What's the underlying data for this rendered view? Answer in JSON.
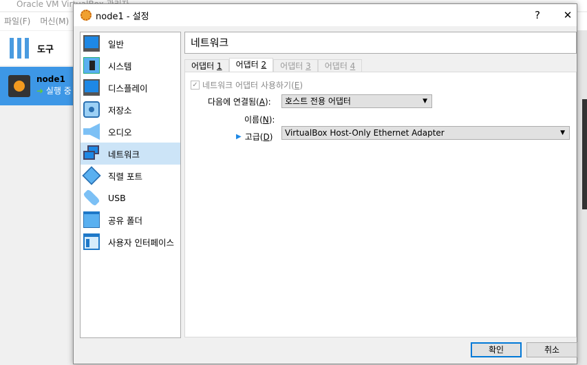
{
  "manager": {
    "title": "Oracle VM VirtualBox 관리자",
    "menu": [
      "파일(F)",
      "머신(M)"
    ],
    "tools_label": "도구",
    "vm": {
      "name": "node1",
      "state": "실행 중"
    }
  },
  "dialog": {
    "title": "node1 - 설정",
    "help": "?",
    "close": "✕",
    "sidebar": [
      {
        "label": "일반",
        "icon": "general-icon"
      },
      {
        "label": "시스템",
        "icon": "system-icon"
      },
      {
        "label": "디스플레이",
        "icon": "display-icon"
      },
      {
        "label": "저장소",
        "icon": "storage-icon"
      },
      {
        "label": "오디오",
        "icon": "audio-icon"
      },
      {
        "label": "네트워크",
        "icon": "network-icon",
        "selected": true
      },
      {
        "label": "직렬 포트",
        "icon": "serial-port-icon"
      },
      {
        "label": "USB",
        "icon": "usb-icon"
      },
      {
        "label": "공유 폴더",
        "icon": "shared-folder-icon"
      },
      {
        "label": "사용자 인터페이스",
        "icon": "user-interface-icon"
      }
    ],
    "page_title": "네트워크",
    "tabs": [
      {
        "label": "어댑터 ",
        "key": "1"
      },
      {
        "label": "어댑터 ",
        "key": "2"
      },
      {
        "label": "어댑터 ",
        "key": "3"
      },
      {
        "label": "어댑터 ",
        "key": "4"
      }
    ],
    "enable": {
      "label": "네트워크 어댑터 사용하기(",
      "key": "E",
      "end": ")",
      "checked": true
    },
    "attached": {
      "label": "다음에 연결됨(",
      "key": "A",
      "end": "):",
      "value": "호스트 전용 어댑터"
    },
    "name": {
      "label": "이름(",
      "key": "N",
      "end": "):",
      "value": "VirtualBox Host-Only Ethernet Adapter"
    },
    "advanced": {
      "label": "고급(",
      "key": "D",
      "end": ")"
    },
    "ok": "확인",
    "cancel": "취소"
  }
}
